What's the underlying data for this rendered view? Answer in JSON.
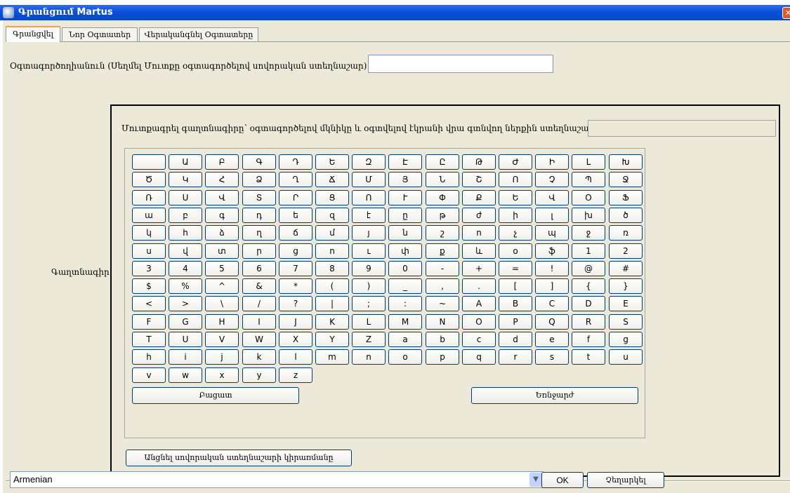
{
  "window": {
    "title_prefix": "Գրանցում",
    "title_app": "Martus"
  },
  "tabs": [
    "Գրանցվել",
    "Նոր Օգտատեր",
    "Վերականգնել Օգտատերը"
  ],
  "username_label": "Օգտագործողիանուն  (Սեղմել Մուտքը օգտագործելով սովորական ստեղնաշար)",
  "keyboard_instructions": "Մուտքագրել գաղտնագիրը՝ օգտագործելով մկնիկը և օգտվելով էկրանի վրա գտնվող ներքին ստեղնաշարից",
  "password_label": "Գաղտնագիր",
  "keys": [
    [
      "",
      "Ա",
      "Բ",
      "Գ",
      "Դ",
      "Ե",
      "Զ",
      "Է",
      "Ը",
      "Թ",
      "Ժ",
      "Ի",
      "Լ",
      "Խ"
    ],
    [
      "Ծ",
      "Կ",
      "Հ",
      "Ձ",
      "Ղ",
      "Ճ",
      "Մ",
      "Յ",
      "Ն",
      "Շ",
      "Ո",
      "Չ",
      "Պ",
      "Ջ"
    ],
    [
      "Ռ",
      "Ս",
      "Վ",
      "Տ",
      "Ր",
      "Ց",
      "Ո",
      "Ւ",
      "Փ",
      "Ք",
      "Ե",
      "Վ",
      "Օ",
      "Ֆ"
    ],
    [
      "ա",
      "բ",
      "գ",
      "դ",
      "ե",
      "զ",
      "է",
      "ը",
      "թ",
      "ժ",
      "ի",
      "լ",
      "խ",
      "ծ"
    ],
    [
      "կ",
      "հ",
      "ձ",
      "ղ",
      "ճ",
      "մ",
      "յ",
      "ն",
      "շ",
      "ո",
      "չ",
      "պ",
      "ջ",
      "ռ"
    ],
    [
      "ս",
      "վ",
      "տ",
      "ր",
      "ց",
      "ո",
      "ւ",
      "փ",
      "ք",
      "և",
      "օ",
      "ֆ",
      "1",
      "2"
    ],
    [
      "3",
      "4",
      "5",
      "6",
      "7",
      "8",
      "9",
      "0",
      "-",
      "+",
      "=",
      "!",
      "@",
      "#"
    ],
    [
      "$",
      "%",
      "^",
      "&",
      "*",
      "(",
      ")",
      "_",
      ",",
      ".",
      "[",
      "]",
      "{",
      "}"
    ],
    [
      "<",
      ">",
      "\\",
      "/",
      "?",
      "|",
      ";",
      ":",
      "~",
      "A",
      "B",
      "C",
      "D",
      "E"
    ],
    [
      "F",
      "G",
      "H",
      "I",
      "J",
      "K",
      "L",
      "M",
      "N",
      "O",
      "P",
      "Q",
      "R",
      "S"
    ],
    [
      "T",
      "U",
      "V",
      "W",
      "X",
      "Y",
      "Z",
      "a",
      "b",
      "c",
      "d",
      "e",
      "f",
      "g"
    ],
    [
      "h",
      "i",
      "j",
      "k",
      "l",
      "m",
      "n",
      "o",
      "p",
      "q",
      "r",
      "s",
      "t",
      "u"
    ],
    [
      "v",
      "w",
      "x",
      "y",
      "z"
    ]
  ],
  "space_label": "Բացատ",
  "backspace_label": "Եռնջարժ",
  "switch_keyboard_label": "Անցնել սովորական ստեղնաշարի կիրառմանը",
  "language": {
    "value": "Armenian"
  },
  "ok_label": "OK",
  "cancel_label": "Չեղարկել",
  "icons": {
    "app": "martus-app-icon",
    "close": "close-icon",
    "dropdown": "chevron-down-icon"
  }
}
